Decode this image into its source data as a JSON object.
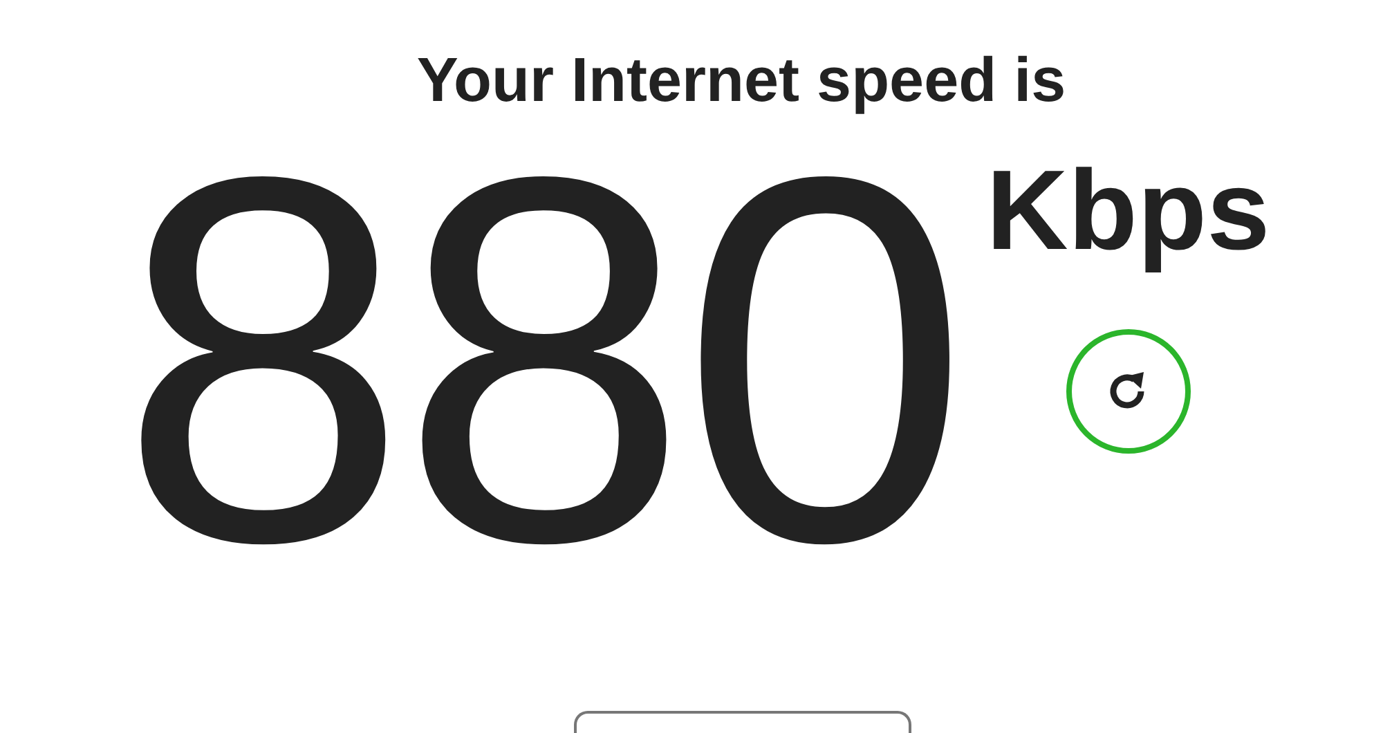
{
  "headline": "Your Internet speed is",
  "speed": {
    "value": "880",
    "unit": "Kbps"
  }
}
